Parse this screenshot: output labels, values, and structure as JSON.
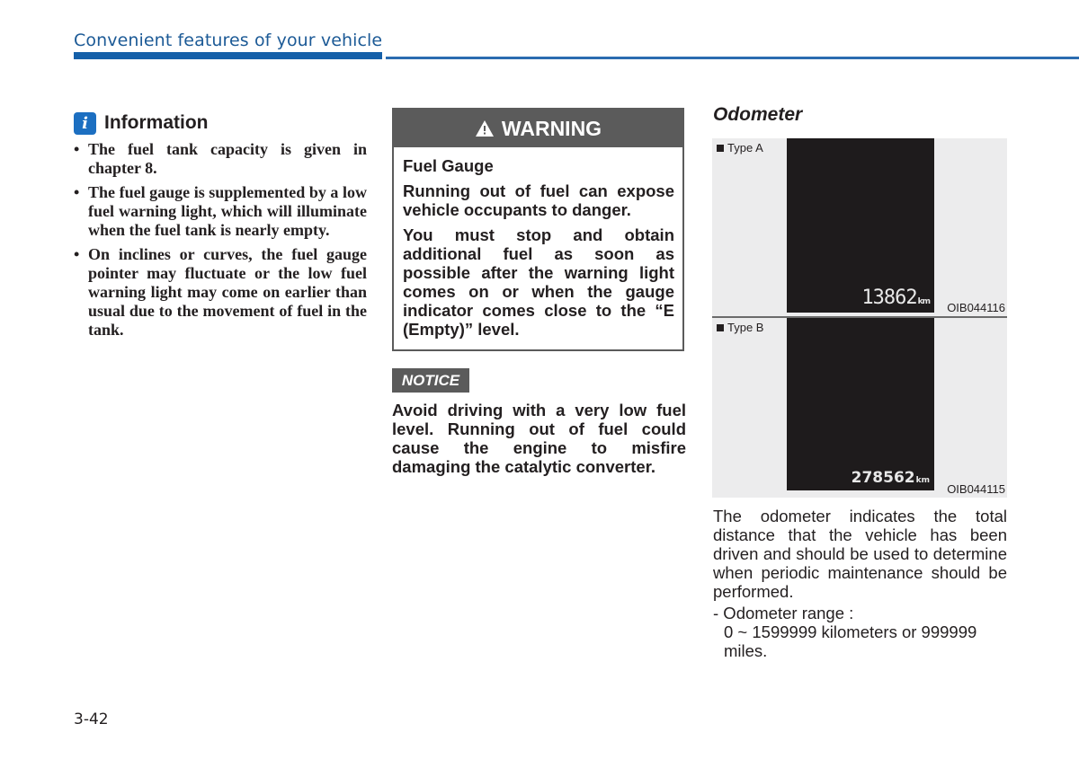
{
  "header": {
    "section_title": "Convenient features of your vehicle",
    "accent_color": "#1560a9"
  },
  "information": {
    "icon": "info-icon",
    "icon_glyph": "i",
    "title": "Information",
    "bullets": [
      "The fuel tank capacity is given in chapter 8.",
      "The fuel gauge is supplemented by a low fuel warning light, which will illuminate when the fuel tank is nearly empty.",
      "On inclines or curves, the fuel gauge pointer may fluctuate or the low fuel warning light may come on earlier than usual due to the movement of fuel in the tank."
    ]
  },
  "warning": {
    "icon": "warning-triangle-icon",
    "title": "WARNING",
    "subtitle": "Fuel Gauge",
    "paragraphs": [
      "Running out of fuel can expose vehicle occupants to danger.",
      "You must stop and obtain additional fuel as soon as possible after the warning light comes on or when the gauge indicator comes close to the “E (Empty)” level."
    ]
  },
  "notice": {
    "label": "NOTICE",
    "text": "Avoid driving with a very low fuel level. Running out of fuel could cause the engine to misfire damaging the catalytic converter."
  },
  "odometer": {
    "title": "Odometer",
    "figures": [
      {
        "label": "Type A",
        "reading": "13862",
        "unit": "km",
        "code": "OIB044116"
      },
      {
        "label": "Type B",
        "reading": "278562",
        "unit": "km",
        "code": "OIB044115"
      }
    ],
    "description": "The odometer indicates the total distance that the vehicle has been driven and should be used to determine when periodic maintenance should be performed.",
    "range_label": "- Odometer range :",
    "range_value": "0 ~ 1599999 kilometers or 999999 miles."
  },
  "page_number": "3-42"
}
